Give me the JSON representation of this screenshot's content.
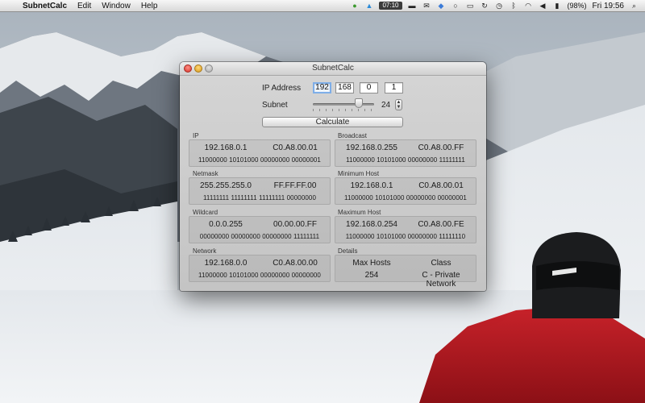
{
  "menubar": {
    "app_name": "SubnetCalc",
    "menus": [
      "Edit",
      "Window",
      "Help"
    ],
    "timer": "07:10",
    "battery": "(98%)",
    "clock": "Fri 19:56"
  },
  "window": {
    "title": "SubnetCalc",
    "ip_label": "IP Address",
    "ip_octets": [
      "192",
      "168",
      "0",
      "1"
    ],
    "subnet_label": "Subnet",
    "subnet_value": "24",
    "subnet_slider_fraction": 0.75,
    "calculate_label": "Calculate",
    "groups": {
      "ip": {
        "label": "IP",
        "dotted": "192.168.0.1",
        "hex": "C0.A8.00.01",
        "binary": "11000000 10101000 00000000 00000001"
      },
      "broadcast": {
        "label": "Broadcast",
        "dotted": "192.168.0.255",
        "hex": "C0.A8.00.FF",
        "binary": "11000000 10101000 00000000 11111111"
      },
      "netmask": {
        "label": "Netmask",
        "dotted": "255.255.255.0",
        "hex": "FF.FF.FF.00",
        "binary": "11111111 11111111 11111111 00000000"
      },
      "min_host": {
        "label": "Minimum Host",
        "dotted": "192.168.0.1",
        "hex": "C0.A8.00.01",
        "binary": "11000000 10101000 00000000 00000001"
      },
      "wildcard": {
        "label": "Wildcard",
        "dotted": "0.0.0.255",
        "hex": "00.00.00.FF",
        "binary": "00000000 00000000 00000000 11111111"
      },
      "max_host": {
        "label": "Maximum Host",
        "dotted": "192.168.0.254",
        "hex": "C0.A8.00.FE",
        "binary": "11000000 10101000 00000000 11111110"
      },
      "network": {
        "label": "Network",
        "dotted": "192.168.0.0",
        "hex": "C0.A8.00.00",
        "binary": "11000000 10101000 00000000 00000000"
      },
      "details": {
        "label": "Details",
        "max_hosts_label": "Max Hosts",
        "class_label": "Class",
        "max_hosts": "254",
        "class": "C - Private Network"
      }
    }
  }
}
